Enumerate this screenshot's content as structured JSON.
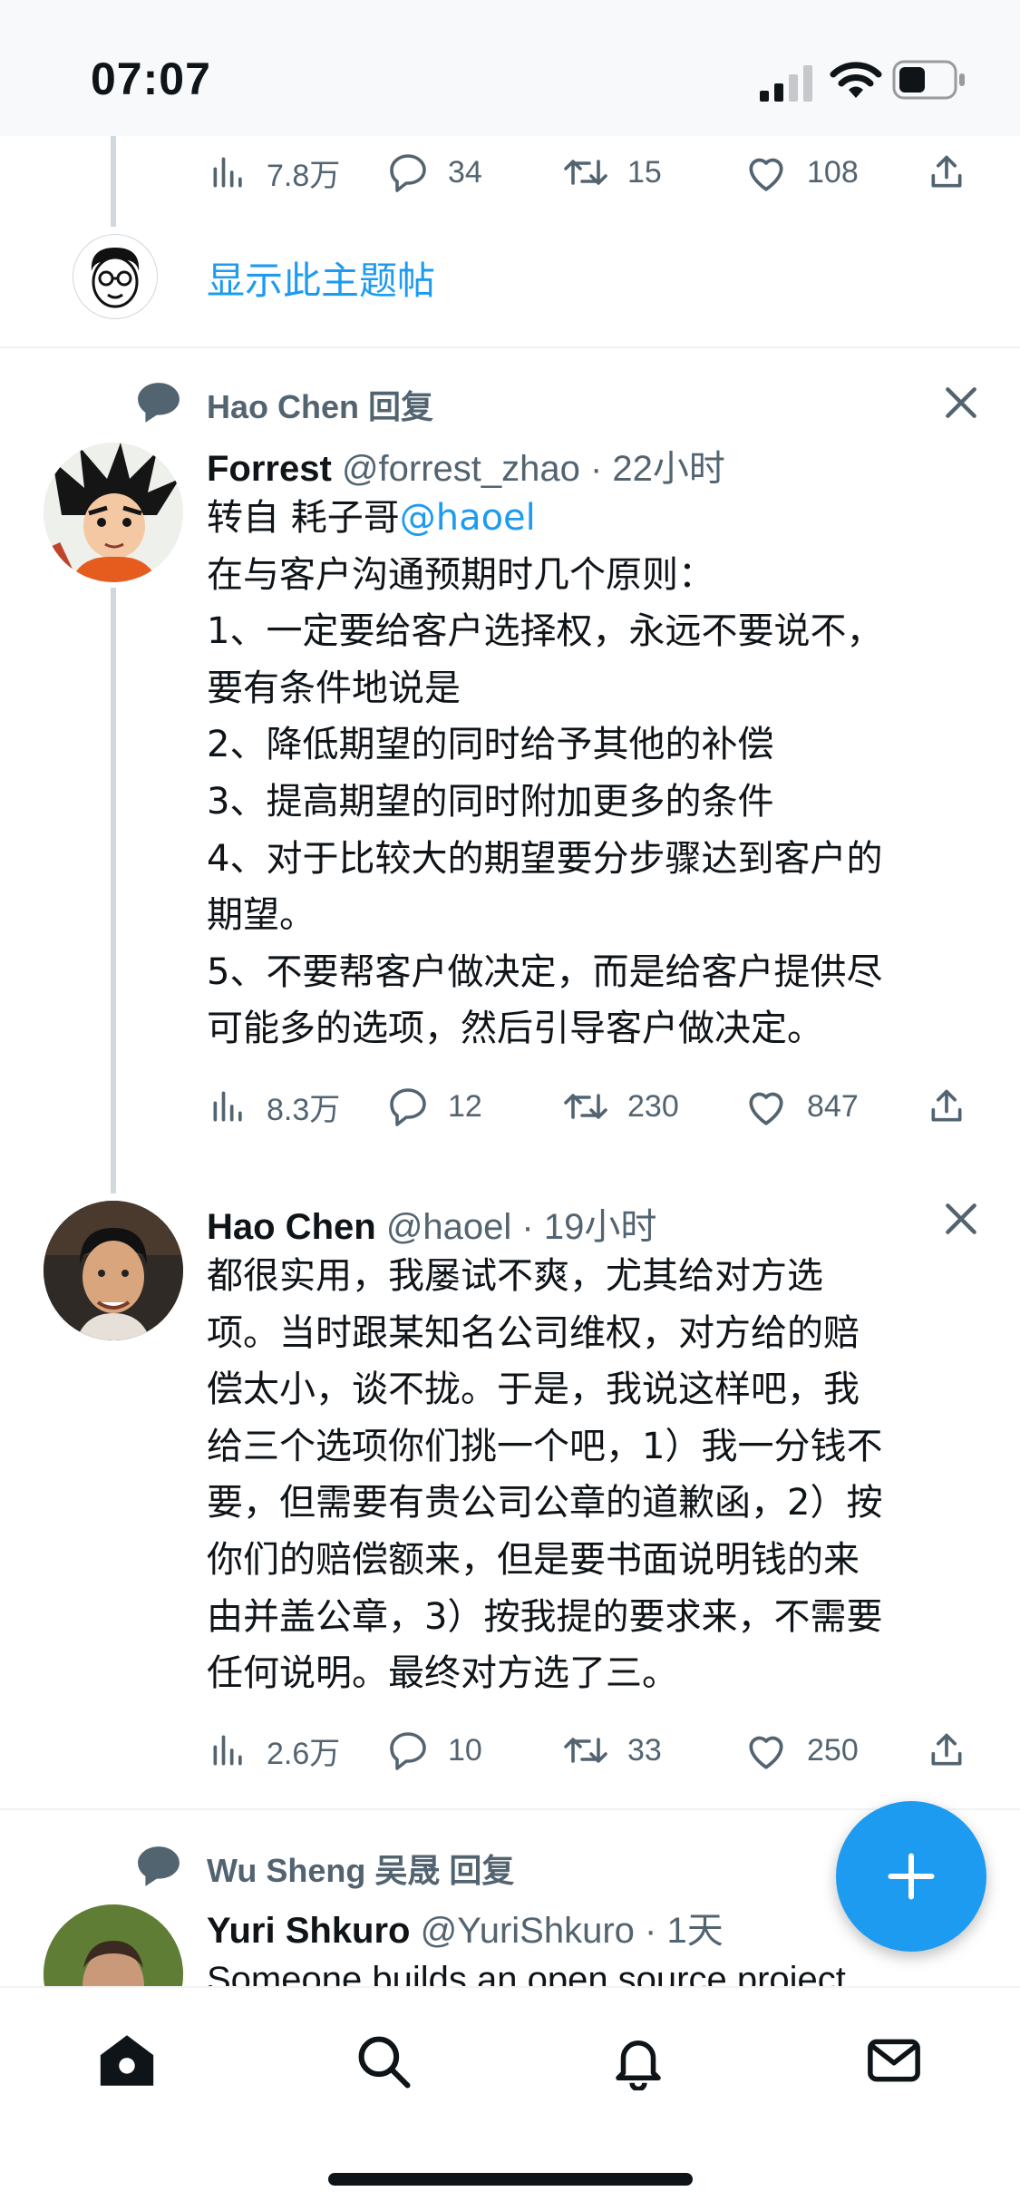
{
  "status_bar": {
    "time": "07:07"
  },
  "thread_top": {
    "actions": {
      "views": "7.8万",
      "replies": "34",
      "retweets": "15",
      "likes": "108"
    },
    "show_thread_label": "显示此主题帖"
  },
  "thread_1": {
    "reply_context": "Hao Chen 回复",
    "tweet_1": {
      "name": "Forrest",
      "meta": "@forrest_zhao · 22小时",
      "lines": [
        {
          "prefix": "转自 耗子哥",
          "mention": "@haoel"
        },
        "在与客户沟通预期时几个原则：",
        "1、一定要给客户选择权，永远不要说不，",
        "要有条件地说是",
        "2、降低期望的同时给予其他的补偿",
        "3、提高期望的同时附加更多的条件",
        "4、对于比较大的期望要分步骤达到客户的",
        "期望。",
        "5、不要帮客户做决定，而是给客户提供尽",
        "可能多的选项，然后引导客户做决定。"
      ],
      "actions": {
        "views": "8.3万",
        "replies": "12",
        "retweets": "230",
        "likes": "847"
      }
    },
    "tweet_2": {
      "name": "Hao Chen",
      "meta": "@haoel · 19小时",
      "lines": [
        "都很实用，我屡试不爽，尤其给对方选",
        "项。当时跟某知名公司维权，对方给的赔",
        "偿太小，谈不拢。于是，我说这样吧，我",
        "给三个选项你们挑一个吧，1）我一分钱不",
        "要，但需要有贵公司公章的道歉函，2）按",
        "你们的赔偿额来，但是要书面说明钱的来",
        "由并盖公章，3）按我提的要求来，不需要",
        "任何说明。最终对方选了三。"
      ],
      "actions": {
        "views": "2.6万",
        "replies": "10",
        "retweets": "33",
        "likes": "250"
      }
    }
  },
  "thread_2": {
    "reply_context": "Wu Sheng 吴晟 回复",
    "tweet_1": {
      "name": "Yuri Shkuro",
      "meta": "@YuriShkuro · 1天",
      "text": "Someone builds an open source project"
    }
  },
  "tabs": [
    "home-icon",
    "search-icon",
    "notifications-icon",
    "messages-icon"
  ],
  "colors": {
    "accent": "#1d9bf0",
    "muted": "#536471",
    "text": "#0f1419"
  }
}
